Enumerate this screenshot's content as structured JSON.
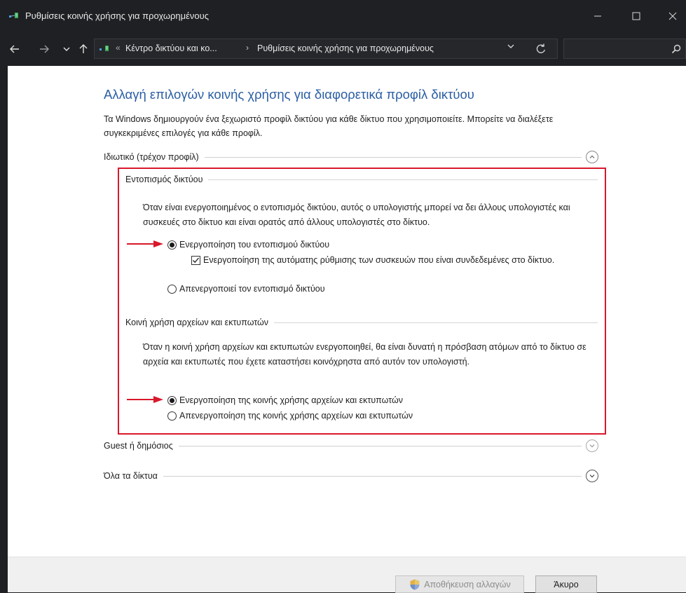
{
  "window": {
    "title": "Ρυθμίσεις κοινής χρήσης για προχωρημένους"
  },
  "address": {
    "crumb_separator": "«",
    "crumbs": [
      "Κέντρο δικτύου και κο...",
      "Ρυθμίσεις κοινής χρήσης για προχωρημένους"
    ],
    "crumb_arrow": "›"
  },
  "page": {
    "heading": "Αλλαγή επιλογών κοινής χρήσης για διαφορετικά προφίλ δικτύου",
    "intro": "Τα Windows δημιουργούν ένα ξεχωριστό προφίλ δικτύου για κάθε δίκτυο που χρησιμοποιείτε. Μπορείτε να διαλέξετε συγκεκριμένες επιλογές για κάθε προφίλ."
  },
  "profiles": {
    "private": {
      "label": "Ιδιωτικό (τρέχον προφίλ)",
      "expanded": true,
      "discovery": {
        "label": "Εντοπισμός δικτύου",
        "description": "Όταν είναι ενεργοποιημένος ο εντοπισμός δικτύου, αυτός ο υπολογιστής μπορεί να δει άλλους υπολογιστές και συσκευές στο δίκτυο και είναι ορατός από άλλους υπολογιστές στο δίκτυο.",
        "option_on": "Ενεργοποίηση του εντοπισμού δικτύου",
        "option_auto": "Ενεργοποίηση της αυτόματης ρύθμισης των συσκευών που είναι συνδεδεμένες στο δίκτυο.",
        "option_off": "Απενεργοποιεί τον εντοπισμό δικτύου",
        "selected": "on",
        "auto_checked": true
      },
      "sharing": {
        "label": "Κοινή χρήση αρχείων και εκτυπωτών",
        "description": "Όταν η κοινή χρήση αρχείων και εκτυπωτών ενεργοποιηθεί, θα είναι δυνατή η πρόσβαση ατόμων από το δίκτυο σε αρχεία και εκτυπωτές που έχετε καταστήσει κοινόχρηστα από αυτόν τον υπολογιστή.",
        "option_on": "Ενεργοποίηση της κοινής χρήσης αρχείων και εκτυπωτών",
        "option_off": "Απενεργοποίηση της κοινής χρήσης αρχείων και εκτυπωτών",
        "selected": "on"
      }
    },
    "guest": {
      "label": "Guest ή δημόσιος",
      "expanded": false
    },
    "all": {
      "label": "Όλα τα δίκτυα",
      "expanded": false
    }
  },
  "footer": {
    "save_label": "Αποθήκευση αλλαγών",
    "cancel_label": "Άκυρο"
  },
  "colors": {
    "heading": "#2a5ea4",
    "highlight_box": "#d9182c",
    "annotation_arrow": "#d9182c"
  }
}
